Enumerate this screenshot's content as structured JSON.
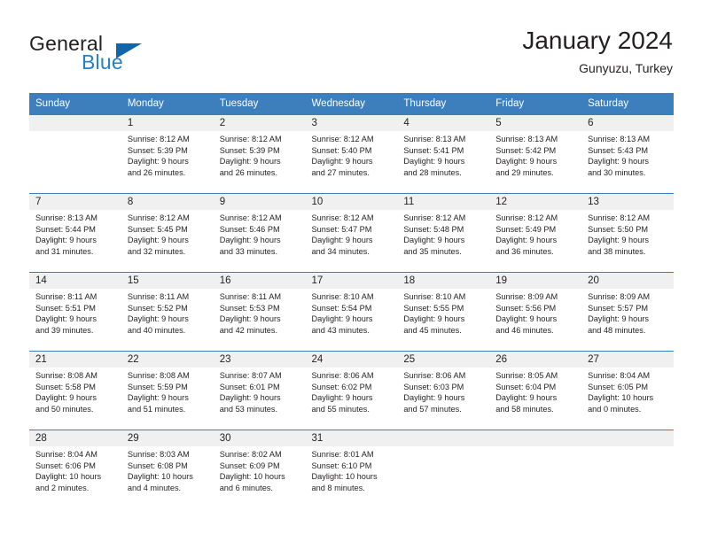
{
  "brand": {
    "name_primary": "General",
    "name_secondary": "Blue",
    "logo_icon": "triangle-flag-icon",
    "color_primary": "#231f20",
    "color_secondary": "#2380c4"
  },
  "header": {
    "title": "January 2024",
    "subtitle": "Gunyuzu, Turkey"
  },
  "theme": {
    "header_bg": "#3d7ebd",
    "daynum_bg": "#f0f0f0",
    "grid_line": "#3d7ebd",
    "text": "#231f20"
  },
  "weekday_headers": [
    "Sunday",
    "Monday",
    "Tuesday",
    "Wednesday",
    "Thursday",
    "Friday",
    "Saturday"
  ],
  "weeks": [
    {
      "days": [
        {
          "number": "",
          "sunrise": "",
          "sunset": "",
          "daylight_line1": "",
          "daylight_line2": ""
        },
        {
          "number": "1",
          "sunrise": "Sunrise: 8:12 AM",
          "sunset": "Sunset: 5:39 PM",
          "daylight_line1": "Daylight: 9 hours",
          "daylight_line2": "and 26 minutes."
        },
        {
          "number": "2",
          "sunrise": "Sunrise: 8:12 AM",
          "sunset": "Sunset: 5:39 PM",
          "daylight_line1": "Daylight: 9 hours",
          "daylight_line2": "and 26 minutes."
        },
        {
          "number": "3",
          "sunrise": "Sunrise: 8:12 AM",
          "sunset": "Sunset: 5:40 PM",
          "daylight_line1": "Daylight: 9 hours",
          "daylight_line2": "and 27 minutes."
        },
        {
          "number": "4",
          "sunrise": "Sunrise: 8:13 AM",
          "sunset": "Sunset: 5:41 PM",
          "daylight_line1": "Daylight: 9 hours",
          "daylight_line2": "and 28 minutes."
        },
        {
          "number": "5",
          "sunrise": "Sunrise: 8:13 AM",
          "sunset": "Sunset: 5:42 PM",
          "daylight_line1": "Daylight: 9 hours",
          "daylight_line2": "and 29 minutes."
        },
        {
          "number": "6",
          "sunrise": "Sunrise: 8:13 AM",
          "sunset": "Sunset: 5:43 PM",
          "daylight_line1": "Daylight: 9 hours",
          "daylight_line2": "and 30 minutes."
        }
      ]
    },
    {
      "days": [
        {
          "number": "7",
          "sunrise": "Sunrise: 8:13 AM",
          "sunset": "Sunset: 5:44 PM",
          "daylight_line1": "Daylight: 9 hours",
          "daylight_line2": "and 31 minutes."
        },
        {
          "number": "8",
          "sunrise": "Sunrise: 8:12 AM",
          "sunset": "Sunset: 5:45 PM",
          "daylight_line1": "Daylight: 9 hours",
          "daylight_line2": "and 32 minutes."
        },
        {
          "number": "9",
          "sunrise": "Sunrise: 8:12 AM",
          "sunset": "Sunset: 5:46 PM",
          "daylight_line1": "Daylight: 9 hours",
          "daylight_line2": "and 33 minutes."
        },
        {
          "number": "10",
          "sunrise": "Sunrise: 8:12 AM",
          "sunset": "Sunset: 5:47 PM",
          "daylight_line1": "Daylight: 9 hours",
          "daylight_line2": "and 34 minutes."
        },
        {
          "number": "11",
          "sunrise": "Sunrise: 8:12 AM",
          "sunset": "Sunset: 5:48 PM",
          "daylight_line1": "Daylight: 9 hours",
          "daylight_line2": "and 35 minutes."
        },
        {
          "number": "12",
          "sunrise": "Sunrise: 8:12 AM",
          "sunset": "Sunset: 5:49 PM",
          "daylight_line1": "Daylight: 9 hours",
          "daylight_line2": "and 36 minutes."
        },
        {
          "number": "13",
          "sunrise": "Sunrise: 8:12 AM",
          "sunset": "Sunset: 5:50 PM",
          "daylight_line1": "Daylight: 9 hours",
          "daylight_line2": "and 38 minutes."
        }
      ]
    },
    {
      "days": [
        {
          "number": "14",
          "sunrise": "Sunrise: 8:11 AM",
          "sunset": "Sunset: 5:51 PM",
          "daylight_line1": "Daylight: 9 hours",
          "daylight_line2": "and 39 minutes."
        },
        {
          "number": "15",
          "sunrise": "Sunrise: 8:11 AM",
          "sunset": "Sunset: 5:52 PM",
          "daylight_line1": "Daylight: 9 hours",
          "daylight_line2": "and 40 minutes."
        },
        {
          "number": "16",
          "sunrise": "Sunrise: 8:11 AM",
          "sunset": "Sunset: 5:53 PM",
          "daylight_line1": "Daylight: 9 hours",
          "daylight_line2": "and 42 minutes."
        },
        {
          "number": "17",
          "sunrise": "Sunrise: 8:10 AM",
          "sunset": "Sunset: 5:54 PM",
          "daylight_line1": "Daylight: 9 hours",
          "daylight_line2": "and 43 minutes."
        },
        {
          "number": "18",
          "sunrise": "Sunrise: 8:10 AM",
          "sunset": "Sunset: 5:55 PM",
          "daylight_line1": "Daylight: 9 hours",
          "daylight_line2": "and 45 minutes."
        },
        {
          "number": "19",
          "sunrise": "Sunrise: 8:09 AM",
          "sunset": "Sunset: 5:56 PM",
          "daylight_line1": "Daylight: 9 hours",
          "daylight_line2": "and 46 minutes."
        },
        {
          "number": "20",
          "sunrise": "Sunrise: 8:09 AM",
          "sunset": "Sunset: 5:57 PM",
          "daylight_line1": "Daylight: 9 hours",
          "daylight_line2": "and 48 minutes."
        }
      ]
    },
    {
      "days": [
        {
          "number": "21",
          "sunrise": "Sunrise: 8:08 AM",
          "sunset": "Sunset: 5:58 PM",
          "daylight_line1": "Daylight: 9 hours",
          "daylight_line2": "and 50 minutes."
        },
        {
          "number": "22",
          "sunrise": "Sunrise: 8:08 AM",
          "sunset": "Sunset: 5:59 PM",
          "daylight_line1": "Daylight: 9 hours",
          "daylight_line2": "and 51 minutes."
        },
        {
          "number": "23",
          "sunrise": "Sunrise: 8:07 AM",
          "sunset": "Sunset: 6:01 PM",
          "daylight_line1": "Daylight: 9 hours",
          "daylight_line2": "and 53 minutes."
        },
        {
          "number": "24",
          "sunrise": "Sunrise: 8:06 AM",
          "sunset": "Sunset: 6:02 PM",
          "daylight_line1": "Daylight: 9 hours",
          "daylight_line2": "and 55 minutes."
        },
        {
          "number": "25",
          "sunrise": "Sunrise: 8:06 AM",
          "sunset": "Sunset: 6:03 PM",
          "daylight_line1": "Daylight: 9 hours",
          "daylight_line2": "and 57 minutes."
        },
        {
          "number": "26",
          "sunrise": "Sunrise: 8:05 AM",
          "sunset": "Sunset: 6:04 PM",
          "daylight_line1": "Daylight: 9 hours",
          "daylight_line2": "and 58 minutes."
        },
        {
          "number": "27",
          "sunrise": "Sunrise: 8:04 AM",
          "sunset": "Sunset: 6:05 PM",
          "daylight_line1": "Daylight: 10 hours",
          "daylight_line2": "and 0 minutes."
        }
      ]
    },
    {
      "days": [
        {
          "number": "28",
          "sunrise": "Sunrise: 8:04 AM",
          "sunset": "Sunset: 6:06 PM",
          "daylight_line1": "Daylight: 10 hours",
          "daylight_line2": "and 2 minutes."
        },
        {
          "number": "29",
          "sunrise": "Sunrise: 8:03 AM",
          "sunset": "Sunset: 6:08 PM",
          "daylight_line1": "Daylight: 10 hours",
          "daylight_line2": "and 4 minutes."
        },
        {
          "number": "30",
          "sunrise": "Sunrise: 8:02 AM",
          "sunset": "Sunset: 6:09 PM",
          "daylight_line1": "Daylight: 10 hours",
          "daylight_line2": "and 6 minutes."
        },
        {
          "number": "31",
          "sunrise": "Sunrise: 8:01 AM",
          "sunset": "Sunset: 6:10 PM",
          "daylight_line1": "Daylight: 10 hours",
          "daylight_line2": "and 8 minutes."
        },
        {
          "number": "",
          "sunrise": "",
          "sunset": "",
          "daylight_line1": "",
          "daylight_line2": ""
        },
        {
          "number": "",
          "sunrise": "",
          "sunset": "",
          "daylight_line1": "",
          "daylight_line2": ""
        },
        {
          "number": "",
          "sunrise": "",
          "sunset": "",
          "daylight_line1": "",
          "daylight_line2": ""
        }
      ]
    }
  ]
}
